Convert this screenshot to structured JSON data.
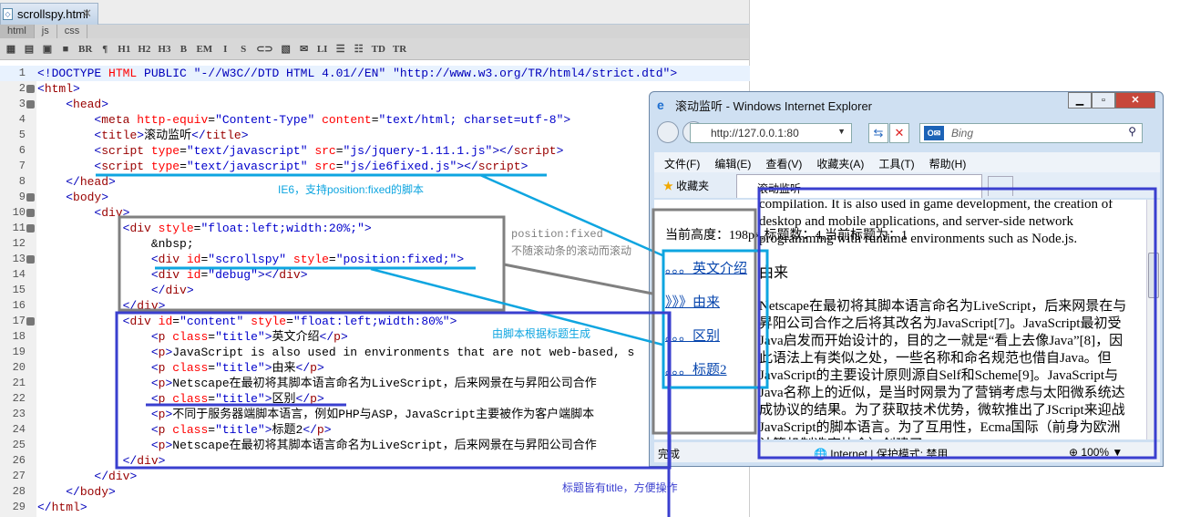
{
  "editor": {
    "file_tab": "scrollspy.html",
    "sub_tabs": [
      "html",
      "js",
      "css"
    ],
    "toolbar": [
      "▦",
      "▤",
      "▣",
      "■",
      "BR",
      "¶",
      "H1",
      "H2",
      "H3",
      "B",
      "EM",
      "I",
      "S",
      "⊂⊃",
      "▧",
      "✉",
      "LI",
      "☰",
      "☷",
      "TD",
      "TR"
    ],
    "lines": [
      [
        [
          "b",
          "<!DOCTYPE "
        ],
        [
          "a",
          "HTML"
        ],
        [
          "b",
          " PUBLIC \"-//W3C//DTD HTML 4.01//EN\" \"http://www.w3.org/TR/html4/strict.dtd\">"
        ]
      ],
      [
        [
          "b",
          "<"
        ],
        [
          "t",
          "html"
        ],
        [
          "b",
          ">"
        ]
      ],
      [
        [
          "k",
          "    "
        ],
        [
          "b",
          "<"
        ],
        [
          "t",
          "head"
        ],
        [
          "b",
          ">"
        ]
      ],
      [
        [
          "k",
          "        "
        ],
        [
          "b",
          "<"
        ],
        [
          "t",
          "meta "
        ],
        [
          "a",
          "http-equiv"
        ],
        [
          "k",
          "="
        ],
        [
          "v",
          "\"Content-Type\" "
        ],
        [
          "a",
          "content"
        ],
        [
          "k",
          "="
        ],
        [
          "v",
          "\"text/html; charset=utf-8\""
        ],
        [
          "b",
          ">"
        ]
      ],
      [
        [
          "k",
          "        "
        ],
        [
          "b",
          "<"
        ],
        [
          "t",
          "title"
        ],
        [
          "b",
          ">"
        ],
        [
          "k",
          "滚动监听"
        ],
        [
          "b",
          "</"
        ],
        [
          "t",
          "title"
        ],
        [
          "b",
          ">"
        ]
      ],
      [
        [
          "k",
          "        "
        ],
        [
          "b",
          "<"
        ],
        [
          "t",
          "script "
        ],
        [
          "a",
          "type"
        ],
        [
          "k",
          "="
        ],
        [
          "v",
          "\"text/javascript\" "
        ],
        [
          "a",
          "src"
        ],
        [
          "k",
          "="
        ],
        [
          "v",
          "\"js/jquery-1.11.1.js\""
        ],
        [
          "b",
          "></"
        ],
        [
          "t",
          "script"
        ],
        [
          "b",
          ">"
        ]
      ],
      [
        [
          "k",
          "        "
        ],
        [
          "b",
          "<"
        ],
        [
          "t",
          "script "
        ],
        [
          "a",
          "type"
        ],
        [
          "k",
          "="
        ],
        [
          "v",
          "\"text/javascript\" "
        ],
        [
          "a",
          "src"
        ],
        [
          "k",
          "="
        ],
        [
          "v",
          "\"js/ie6fixed.js\""
        ],
        [
          "b",
          "></"
        ],
        [
          "t",
          "script"
        ],
        [
          "b",
          ">"
        ]
      ],
      [
        [
          "k",
          "    "
        ],
        [
          "b",
          "</"
        ],
        [
          "t",
          "head"
        ],
        [
          "b",
          ">"
        ]
      ],
      [
        [
          "k",
          "    "
        ],
        [
          "b",
          "<"
        ],
        [
          "t",
          "body"
        ],
        [
          "b",
          ">"
        ]
      ],
      [
        [
          "k",
          "        "
        ],
        [
          "b",
          "<"
        ],
        [
          "t",
          "div"
        ],
        [
          "b",
          ">"
        ]
      ],
      [
        [
          "k",
          "            "
        ],
        [
          "b",
          "<"
        ],
        [
          "t",
          "div "
        ],
        [
          "a",
          "style"
        ],
        [
          "k",
          "="
        ],
        [
          "v",
          "\"float:left;width:20%;\""
        ],
        [
          "b",
          ">"
        ]
      ],
      [
        [
          "k",
          "                &nbsp;"
        ]
      ],
      [
        [
          "k",
          "                "
        ],
        [
          "b",
          "<"
        ],
        [
          "t",
          "div "
        ],
        [
          "a",
          "id"
        ],
        [
          "k",
          "="
        ],
        [
          "v",
          "\"scrollspy\" "
        ],
        [
          "a",
          "style"
        ],
        [
          "k",
          "="
        ],
        [
          "v",
          "\"position:fixed;\""
        ],
        [
          "b",
          ">"
        ]
      ],
      [
        [
          "k",
          "                "
        ],
        [
          "b",
          "<"
        ],
        [
          "t",
          "div "
        ],
        [
          "a",
          "id"
        ],
        [
          "k",
          "="
        ],
        [
          "v",
          "\"debug\""
        ],
        [
          "b",
          "></"
        ],
        [
          "t",
          "div"
        ],
        [
          "b",
          ">"
        ]
      ],
      [
        [
          "k",
          "                "
        ],
        [
          "b",
          "</"
        ],
        [
          "t",
          "div"
        ],
        [
          "b",
          ">"
        ]
      ],
      [
        [
          "k",
          "            "
        ],
        [
          "b",
          "</"
        ],
        [
          "t",
          "div"
        ],
        [
          "b",
          ">"
        ]
      ],
      [
        [
          "k",
          "            "
        ],
        [
          "b",
          "<"
        ],
        [
          "t",
          "div "
        ],
        [
          "a",
          "id"
        ],
        [
          "k",
          "="
        ],
        [
          "v",
          "\"content\" "
        ],
        [
          "a",
          "style"
        ],
        [
          "k",
          "="
        ],
        [
          "v",
          "\"float:left;width:80%\""
        ],
        [
          "b",
          ">"
        ]
      ],
      [
        [
          "k",
          "                "
        ],
        [
          "b",
          "<"
        ],
        [
          "t",
          "p "
        ],
        [
          "a",
          "class"
        ],
        [
          "k",
          "="
        ],
        [
          "v",
          "\"title\""
        ],
        [
          "b",
          ">"
        ],
        [
          "k",
          "英文介绍"
        ],
        [
          "b",
          "</"
        ],
        [
          "t",
          "p"
        ],
        [
          "b",
          ">"
        ]
      ],
      [
        [
          "k",
          "                "
        ],
        [
          "b",
          "<"
        ],
        [
          "t",
          "p"
        ],
        [
          "b",
          ">"
        ],
        [
          "k",
          "JavaScript is also used in environments that are not web-based, s"
        ]
      ],
      [
        [
          "k",
          "                "
        ],
        [
          "b",
          "<"
        ],
        [
          "t",
          "p "
        ],
        [
          "a",
          "class"
        ],
        [
          "k",
          "="
        ],
        [
          "v",
          "\"title\""
        ],
        [
          "b",
          ">"
        ],
        [
          "k",
          "由来"
        ],
        [
          "b",
          "</"
        ],
        [
          "t",
          "p"
        ],
        [
          "b",
          ">"
        ]
      ],
      [
        [
          "k",
          "                "
        ],
        [
          "b",
          "<"
        ],
        [
          "t",
          "p"
        ],
        [
          "b",
          ">"
        ],
        [
          "k",
          "Netscape在最初将其脚本语言命名为LiveScript，后来网景在与昇阳公司合作"
        ]
      ],
      [
        [
          "k",
          "                "
        ],
        [
          "b",
          "<"
        ],
        [
          "t",
          "p "
        ],
        [
          "a",
          "class"
        ],
        [
          "k",
          "="
        ],
        [
          "v",
          "\"title\""
        ],
        [
          "b",
          ">"
        ],
        [
          "k",
          "区别"
        ],
        [
          "b",
          "</"
        ],
        [
          "t",
          "p"
        ],
        [
          "b",
          ">"
        ]
      ],
      [
        [
          "k",
          "                "
        ],
        [
          "b",
          "<"
        ],
        [
          "t",
          "p"
        ],
        [
          "b",
          ">"
        ],
        [
          "k",
          "不同于服务器端脚本语言，例如PHP与ASP，JavaScript主要被作为客户端脚本"
        ]
      ],
      [
        [
          "k",
          "                "
        ],
        [
          "b",
          "<"
        ],
        [
          "t",
          "p "
        ],
        [
          "a",
          "class"
        ],
        [
          "k",
          "="
        ],
        [
          "v",
          "\"title\""
        ],
        [
          "b",
          ">"
        ],
        [
          "k",
          "标题2"
        ],
        [
          "b",
          "</"
        ],
        [
          "t",
          "p"
        ],
        [
          "b",
          ">"
        ]
      ],
      [
        [
          "k",
          "                "
        ],
        [
          "b",
          "<"
        ],
        [
          "t",
          "p"
        ],
        [
          "b",
          ">"
        ],
        [
          "k",
          "Netscape在最初将其脚本语言命名为LiveScript，后来网景在与昇阳公司合作"
        ]
      ],
      [
        [
          "k",
          "            "
        ],
        [
          "b",
          "</"
        ],
        [
          "t",
          "div"
        ],
        [
          "b",
          ">"
        ]
      ],
      [
        [
          "k",
          "        "
        ],
        [
          "b",
          "</"
        ],
        [
          "t",
          "div"
        ],
        [
          "b",
          ">"
        ]
      ],
      [
        [
          "k",
          "    "
        ],
        [
          "b",
          "</"
        ],
        [
          "t",
          "body"
        ],
        [
          "b",
          ">"
        ]
      ],
      [
        [
          "b",
          "</"
        ],
        [
          "t",
          "html"
        ],
        [
          "b",
          ">"
        ]
      ]
    ],
    "fold_lines": [
      2,
      3,
      9,
      10,
      11,
      13,
      17
    ]
  },
  "ie": {
    "title": "滚动监听 - Windows Internet Explorer",
    "address": "http://127.0.0.1:80",
    "search_placeholder": "Bing",
    "menu": [
      "文件(F)",
      "编辑(E)",
      "查看(V)",
      "收藏夹(A)",
      "工具(T)",
      "帮助(H)"
    ],
    "favorites": "收藏夹",
    "tab_title": "滚动监听",
    "spy_info": "当前高度：198px,标题数：4,当前标题为：1",
    "spy_links": [
      "。。。英文介绍",
      "》》》由来",
      "。。。区别",
      "。。。标题2"
    ],
    "content": [
      {
        "cls": "",
        "text": "compilation. It is also used in game development, the creation of desktop and mobile applications, and server-side network programming with runtime environments such as Node.js."
      },
      {
        "cls": "ttl",
        "text": "由来"
      },
      {
        "cls": "",
        "text": "Netscape在最初将其脚本语言命名为LiveScript，后来网景在与昇阳公司合作之后将其改名为JavaScript[7]。JavaScript最初受Java启发而开始设计的，目的之一就是“看上去像Java”[8]，因此语法上有类似之处，一些名称和命名规范也借自Java。但JavaScript的主要设计原则源自Self和Scheme[9]。JavaScript与Java名称上的近似，是当时网景为了营销考虑与太阳微系统达成协议的结果。为了获取技术优势，微软推出了JScript来迎战JavaScript的脚本语言。为了互用性，Ecma国际（前身为欧洲计算机制造商协会）创建了ECMA"
      }
    ],
    "status_done": "完成",
    "status_zone": "Internet | 保护模式: 禁用",
    "status_zoom": "100%"
  },
  "annotations": {
    "ie6": "IE6，支持position:fixed的脚本",
    "fixed1": "position:fixed",
    "fixed2": "不随滚动条的滚动而滚动",
    "generated": "由脚本根据标题生成",
    "titles": "标题皆有title，方便操作"
  },
  "colors": {
    "cyan": "#0ea5e0",
    "gray": "#808080",
    "blue": "#3a3fcf"
  }
}
